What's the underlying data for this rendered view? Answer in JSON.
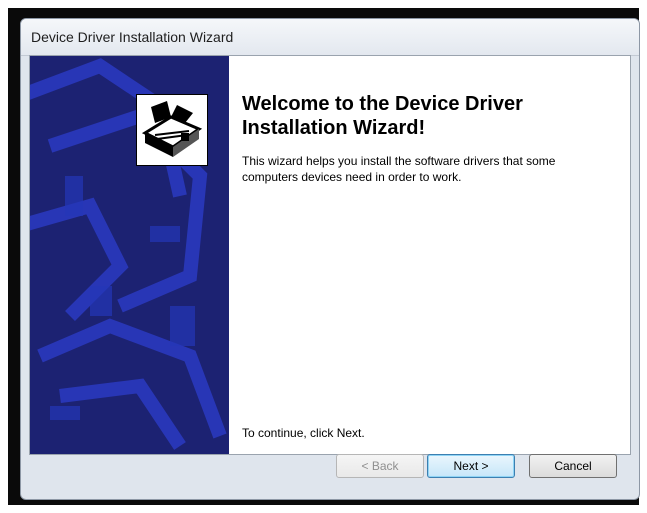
{
  "window": {
    "title": "Device Driver Installation Wizard"
  },
  "wizard": {
    "heading_line1": "Welcome to the Device Driver",
    "heading_line2": "Installation Wizard!",
    "intro_line1": "This wizard helps you install the software drivers that some",
    "intro_line2": "computers devices need in order to work.",
    "continue_text": "To continue, click Next.",
    "icon": "installer-box-icon"
  },
  "buttons": {
    "back_label": "< Back",
    "next_label": "Next >",
    "cancel_label": "Cancel",
    "back_enabled": false
  },
  "colors": {
    "side_panel": "#1c2272",
    "side_panel_pattern": "#2b3ac2",
    "next_highlight": "#3c7fb1"
  }
}
